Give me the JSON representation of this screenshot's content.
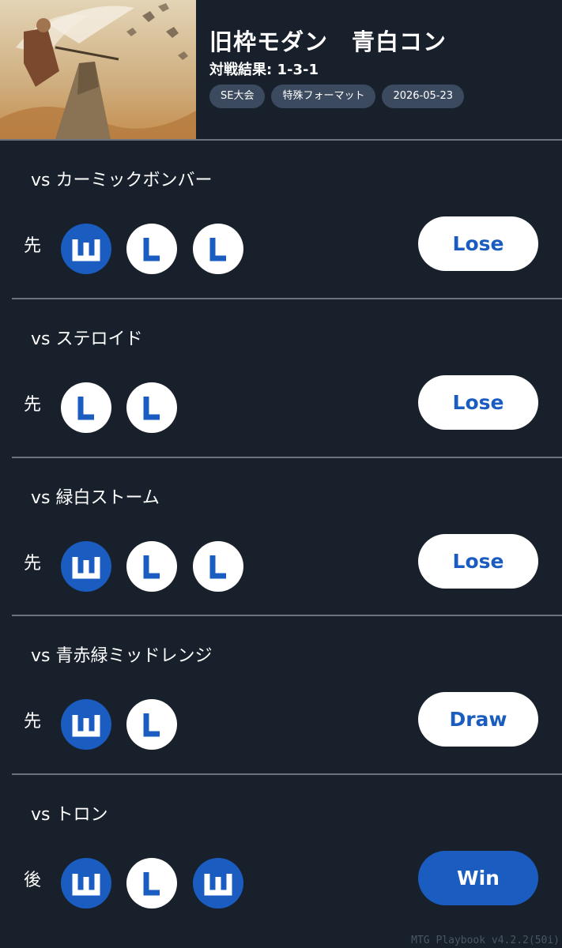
{
  "header": {
    "title": "旧枠モダン　青白コン",
    "record": "対戦結果: 1-3-1",
    "tags": [
      "SE大会",
      "特殊フォーマット",
      "2026-05-23"
    ]
  },
  "matches": [
    {
      "opponent": "vs カーミックボンバー",
      "order": "先",
      "games": [
        "W",
        "L",
        "L"
      ],
      "result": "Lose"
    },
    {
      "opponent": "vs ステロイド",
      "order": "先",
      "games": [
        "L",
        "L"
      ],
      "result": "Lose"
    },
    {
      "opponent": "vs 緑白ストーム",
      "order": "先",
      "games": [
        "W",
        "L",
        "L"
      ],
      "result": "Lose"
    },
    {
      "opponent": "vs 青赤緑ミッドレンジ",
      "order": "先",
      "games": [
        "W",
        "L"
      ],
      "result": "Draw"
    },
    {
      "opponent": "vs トロン",
      "order": "後",
      "games": [
        "W",
        "L",
        "W"
      ],
      "result": "Win"
    }
  ],
  "footer": {
    "version": "MTG Playbook v4.2.2(50i)"
  },
  "colors": {
    "background": "#18202b",
    "accent": "#1a5cc0",
    "tag_bg": "#3b4a5e",
    "divider": "#6b7380"
  },
  "icons": {
    "game_win": "w-letter-icon",
    "game_loss": "l-letter-icon"
  }
}
